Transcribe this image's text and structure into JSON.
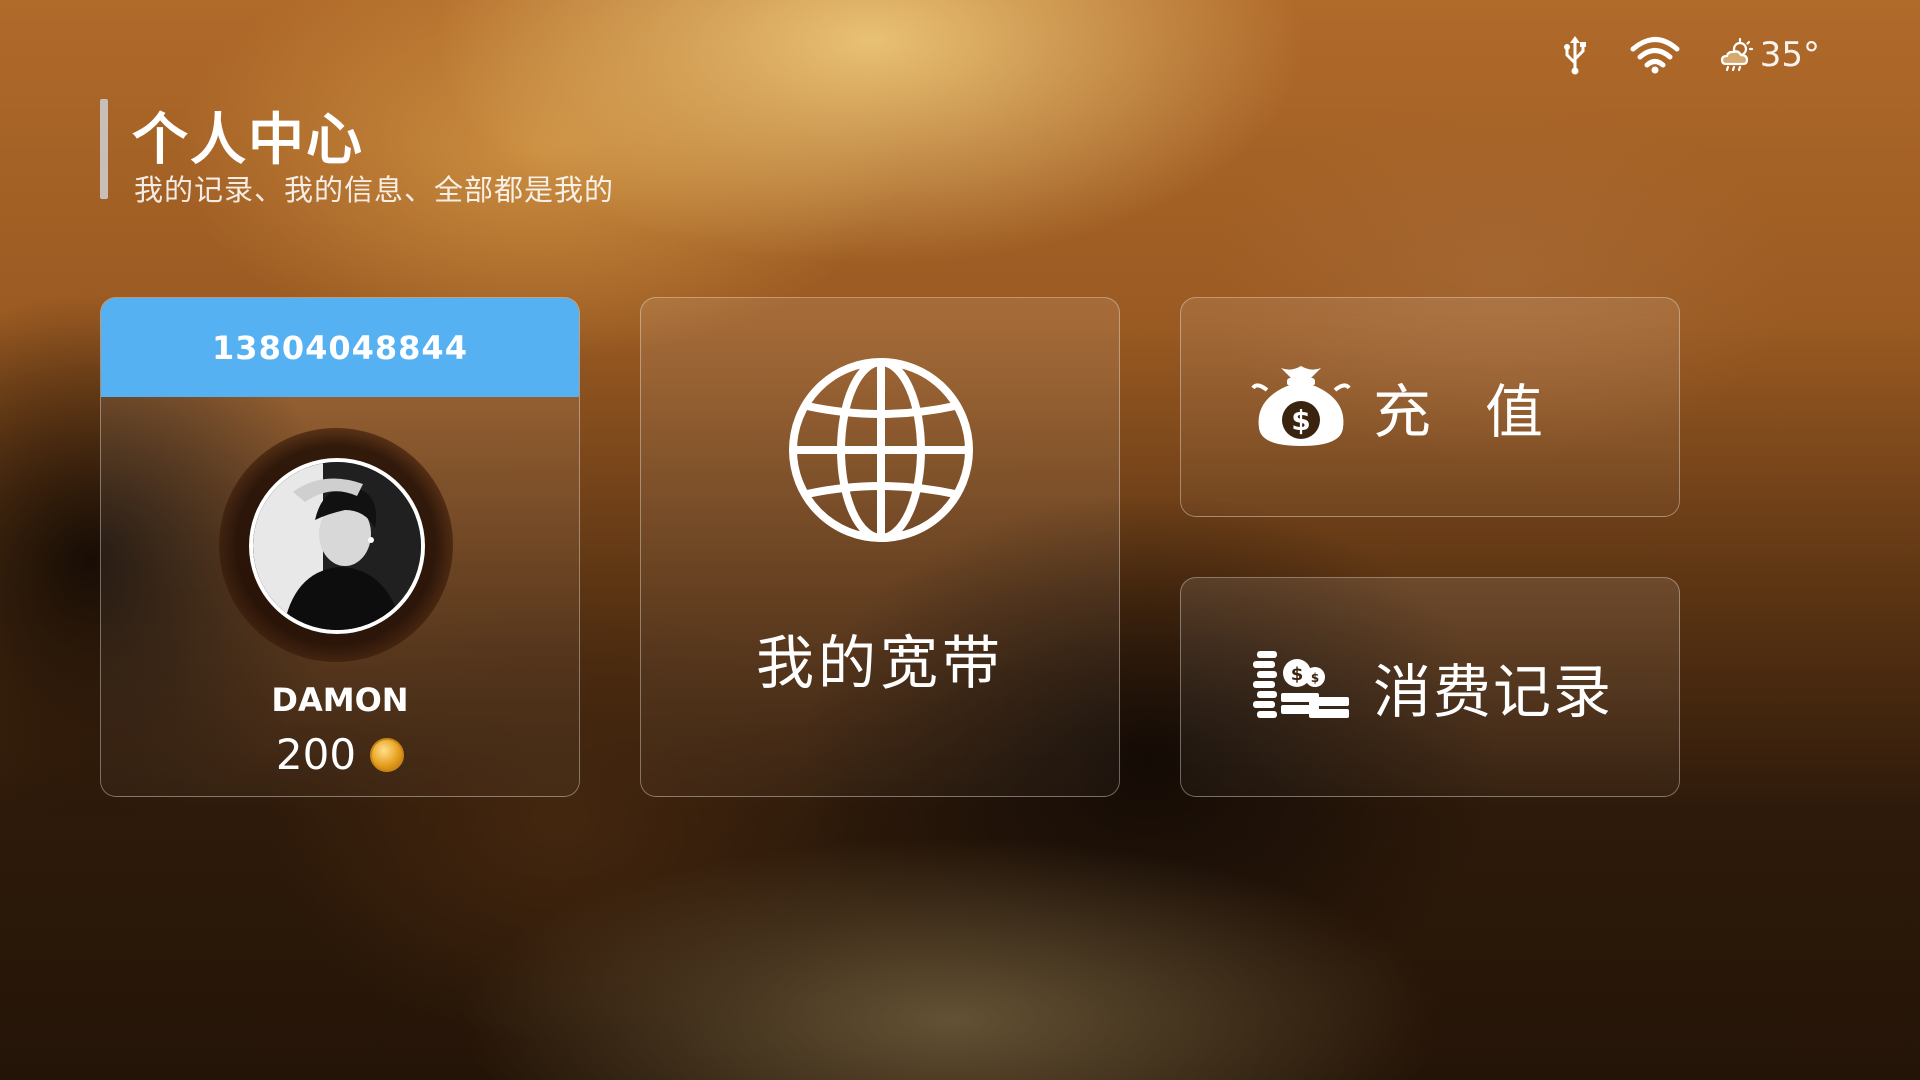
{
  "header": {
    "title": "个人中心",
    "subtitle": "我的记录、我的信息、全部都是我的"
  },
  "status_bar": {
    "icons": [
      "usb-icon",
      "wifi-icon",
      "weather-cloudy-icon"
    ],
    "temperature": "35°"
  },
  "profile_card": {
    "phone": "13804048844",
    "username": "DAMON",
    "points": "200",
    "coin_icon": "coin-icon"
  },
  "broadband_card": {
    "icon": "globe-icon",
    "label": "我的宽带"
  },
  "recharge_card": {
    "icon": "money-bag-icon",
    "label": "充值"
  },
  "history_card": {
    "icon": "coins-cash-icon",
    "label": "消费记录"
  },
  "colors": {
    "phone_bar": "#56b1f2",
    "text": "#ffffff"
  }
}
